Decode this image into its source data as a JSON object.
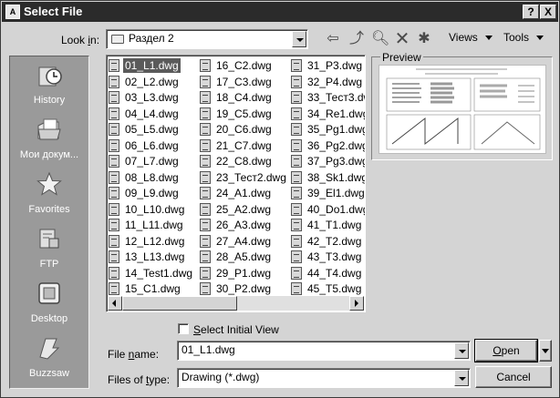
{
  "window": {
    "title": "Select File",
    "help_label": "?",
    "close_label": "X"
  },
  "lookin": {
    "label": "Look in:",
    "value": "Раздел 2"
  },
  "toolbar": {
    "icons": [
      "back-icon",
      "up-folder-icon",
      "search-web-icon",
      "delete-icon",
      "create-folder-icon"
    ],
    "views_label": "Views",
    "tools_label": "Tools"
  },
  "places": [
    {
      "label": "History",
      "icon": "history-icon"
    },
    {
      "label": "Мои докум...",
      "icon": "my-documents-icon"
    },
    {
      "label": "Favorites",
      "icon": "favorites-icon"
    },
    {
      "label": "FTP",
      "icon": "ftp-icon"
    },
    {
      "label": "Desktop",
      "icon": "desktop-icon"
    },
    {
      "label": "Buzzsaw",
      "icon": "buzzsaw-icon"
    }
  ],
  "files": {
    "selected": "01_L1.dwg",
    "columns": [
      [
        "01_L1.dwg",
        "02_L2.dwg",
        "03_L3.dwg",
        "04_L4.dwg",
        "05_L5.dwg",
        "06_L6.dwg",
        "07_L7.dwg",
        "08_L8.dwg",
        "09_L9.dwg",
        "10_L10.dwg",
        "11_L11.dwg",
        "12_L12.dwg",
        "13_L13.dwg",
        "14_Test1.dwg",
        "15_C1.dwg"
      ],
      [
        "16_C2.dwg",
        "17_C3.dwg",
        "18_C4.dwg",
        "19_C5.dwg",
        "20_C6.dwg",
        "21_C7.dwg",
        "22_C8.dwg",
        "23_Тест2.dwg",
        "24_A1.dwg",
        "25_A2.dwg",
        "26_A3.dwg",
        "27_A4.dwg",
        "28_A5.dwg",
        "29_P1.dwg",
        "30_P2.dwg"
      ],
      [
        "31_P3.dwg",
        "32_P4.dwg",
        "33_Тест3.dw",
        "34_Re1.dwg",
        "35_Pg1.dwg",
        "36_Pg2.dwg",
        "37_Pg3.dwg",
        "38_Sk1.dwg",
        "39_El1.dwg",
        "40_Do1.dwg",
        "41_T1.dwg",
        "42_T2.dwg",
        "43_T3.dwg",
        "44_T4.dwg",
        "45_T5.dwg"
      ]
    ]
  },
  "preview": {
    "label": "Preview"
  },
  "options": {
    "select_initial_view": "Select Initial View",
    "checked": false
  },
  "filename": {
    "label": "File name:",
    "value": "01_L1.dwg"
  },
  "filetype": {
    "label": "Files of type:",
    "value": "Drawing (*.dwg)"
  },
  "buttons": {
    "open": "Open",
    "cancel": "Cancel"
  }
}
